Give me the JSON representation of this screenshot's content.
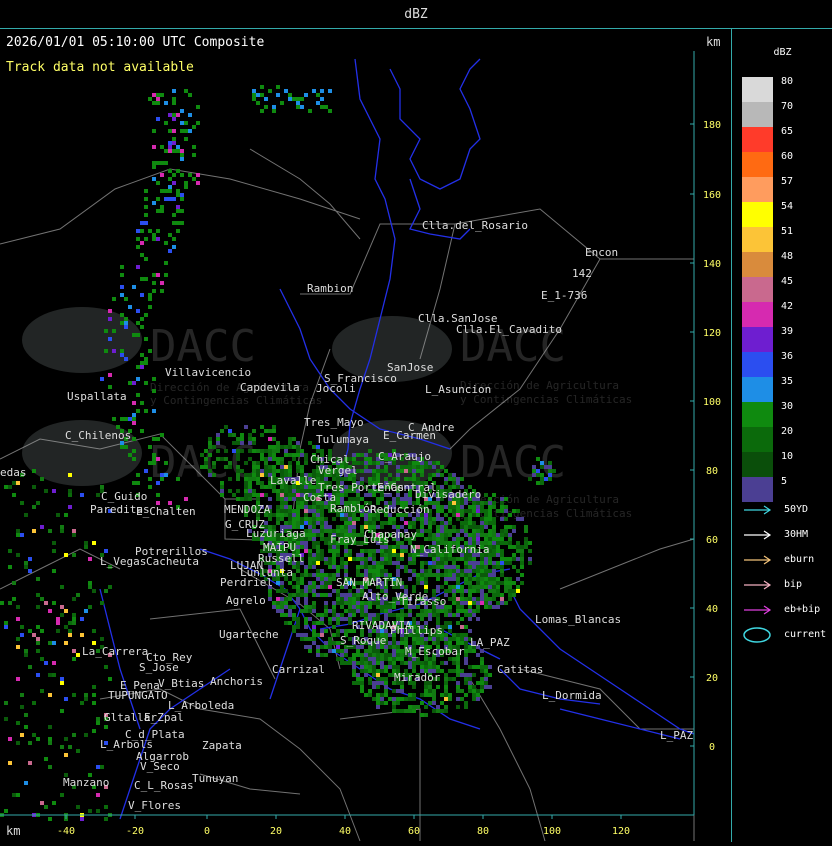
{
  "window": {
    "title": "dBZ"
  },
  "map": {
    "header": "2026/01/01 05:10:00 UTC Composite",
    "track_message": "Track data not available",
    "axis_unit": "km",
    "x_ticks": [
      "-40",
      "-20",
      "0",
      "20",
      "40",
      "60",
      "80",
      "100",
      "120"
    ],
    "y_ticks": [
      "180",
      "160",
      "140",
      "120",
      "100",
      "80",
      "60",
      "40",
      "20",
      "0"
    ],
    "watermark_lines": [
      "Dirección de Agricultura",
      "y Contingencias Climáticas"
    ],
    "places": [
      "Clla.del_Rosario",
      "Rambion",
      "Encon",
      "142",
      "E_1-736",
      "Clla.SanJose",
      "Clla.El_Cavadito",
      "Villavicencio",
      "Capdevila",
      "Jocoli",
      "S_Francisco",
      "SanJose",
      "L_Asuncion",
      "Uspallata",
      "C_Chilenos",
      "Tres_Mayo",
      "Tulumaya",
      "E_Carmen",
      "C_Andre",
      "C_Araujo",
      "Chical",
      "Vergel",
      "Lavalle",
      "Costa",
      "E_Central",
      "Divisadero",
      "Tres Porteñas",
      "Ramblón",
      "Reducción",
      "MENDOZA",
      "G_CRUZ",
      "Luzuriaga",
      "Russell",
      "MAIPU",
      "Lunlunta",
      "Perdriel",
      "LUJAN",
      "Chapanay",
      "Fray_Luis",
      "N_California",
      "C_Guido",
      "E_Chalten",
      "Potrerillos",
      "Cacheuta",
      "L_Vegas",
      "Agrelo",
      "Ugarteche",
      "Carrizal",
      "Anchoris",
      "E_Pena",
      "TUPUNGATO",
      "Cto_Rey",
      "S_Jose",
      "La_Carrera",
      "V_Btias",
      "L_Arboleda",
      "Gltallar",
      "E_Zpal",
      "C_d_Plata",
      "L_Arbols",
      "Zapata",
      "Algarrob",
      "V_Seco",
      "Tunuyan",
      "Manzano",
      "C_L_Rosas",
      "V_Flores",
      "SAN_MARTIN",
      "RIVADAVIA",
      "Phillips",
      "Alto_Verde",
      "S_Roque",
      "M_Escobar",
      "Lomas_Blancas",
      "Catitas",
      "L_Dormida",
      "L_PAZ",
      "Tirasso",
      "LA_PAZ",
      "Mirador",
      "edas",
      "Pareditas"
    ]
  },
  "legend": {
    "title": "dBZ",
    "levels": [
      {
        "value": "80",
        "color": "#d9d9d9"
      },
      {
        "value": "70",
        "color": "#b8b8b8"
      },
      {
        "value": "65",
        "color": "#ff3b2a"
      },
      {
        "value": "60",
        "color": "#ff6a12"
      },
      {
        "value": "57",
        "color": "#ff9c5e"
      },
      {
        "value": "54",
        "color": "#ffff00"
      },
      {
        "value": "51",
        "color": "#fcc437"
      },
      {
        "value": "48",
        "color": "#d98b3c"
      },
      {
        "value": "45",
        "color": "#c9698e"
      },
      {
        "value": "42",
        "color": "#d62ab0"
      },
      {
        "value": "39",
        "color": "#6e1ed0"
      },
      {
        "value": "36",
        "color": "#2b4ef0"
      },
      {
        "value": "35",
        "color": "#1e8ee6"
      },
      {
        "value": "30",
        "color": "#0f8a0f"
      },
      {
        "value": "20",
        "color": "#0b6a0b"
      },
      {
        "value": "10",
        "color": "#0a4e0a"
      },
      {
        "value": "5",
        "color": "#4b3f93"
      }
    ],
    "tracks": [
      {
        "label": "50YD",
        "color": "#3fd6e0"
      },
      {
        "label": "30HM",
        "color": "#ffffff"
      },
      {
        "label": "eburn",
        "color": "#f2c27a"
      },
      {
        "label": "bip",
        "color": "#f2b0c0"
      },
      {
        "label": "eb+bip",
        "color": "#e040e0"
      },
      {
        "label": "current",
        "color": "#3fd6e0"
      }
    ]
  }
}
